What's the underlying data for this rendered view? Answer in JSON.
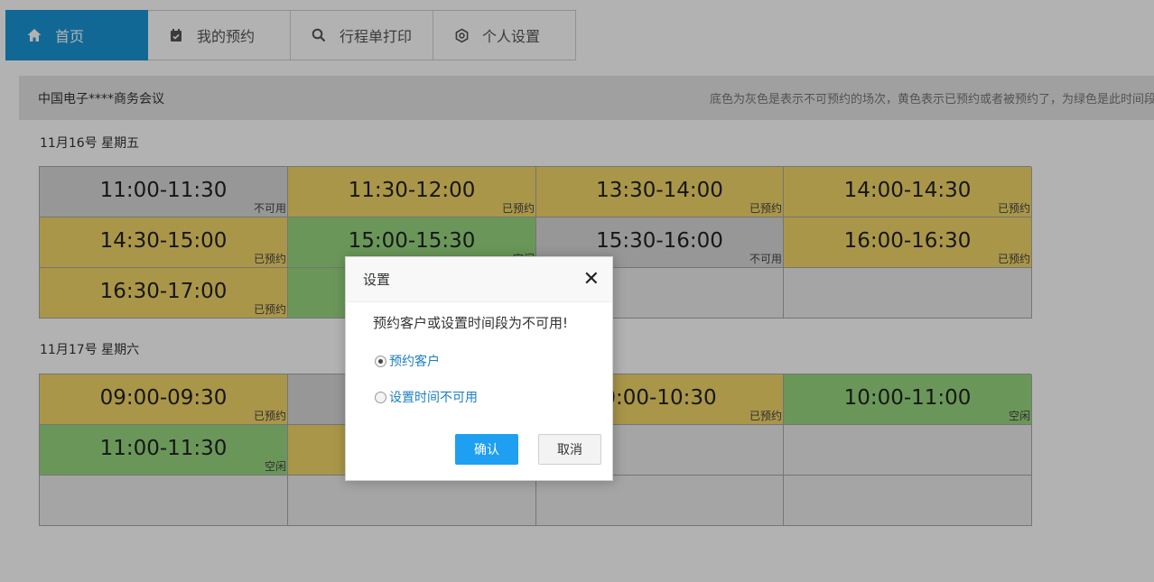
{
  "nav": {
    "tabs": [
      {
        "label": "首页",
        "icon": "home-icon",
        "active": true
      },
      {
        "label": "我的预约",
        "icon": "calendar-check-icon",
        "active": false
      },
      {
        "label": "行程单打印",
        "icon": "search-icon",
        "active": false
      },
      {
        "label": "个人设置",
        "icon": "gear-icon",
        "active": false
      }
    ]
  },
  "infobar": {
    "title": "中国电子****商务会议",
    "legend": "底色为灰色是表示不可预约的场次，黄色表示已预约或者被预约了，为绿色是此时间段"
  },
  "days": [
    {
      "label": "11月16号 星期五",
      "slots": [
        {
          "time": "11:00-11:30",
          "status": "不可用",
          "state": "gray"
        },
        {
          "time": "11:30-12:00",
          "status": "已预约",
          "state": "yellow"
        },
        {
          "time": "13:30-14:00",
          "status": "已预约",
          "state": "yellow"
        },
        {
          "time": "14:00-14:30",
          "status": "已预约",
          "state": "yellow"
        },
        {
          "time": "14:30-15:00",
          "status": "已预约",
          "state": "yellow"
        },
        {
          "time": "15:00-15:30",
          "status": "空闲",
          "state": "green"
        },
        {
          "time": "15:30-16:00",
          "status": "不可用",
          "state": "gray"
        },
        {
          "time": "16:00-16:30",
          "status": "已预约",
          "state": "yellow"
        },
        {
          "time": "16:30-17:00",
          "status": "已预约",
          "state": "yellow"
        },
        {
          "time": "",
          "status": "",
          "state": "green"
        },
        {
          "time": "",
          "status": "",
          "state": "empty"
        },
        {
          "time": "",
          "status": "",
          "state": "empty"
        }
      ]
    },
    {
      "label": "11月17号 星期六",
      "slots": [
        {
          "time": "09:00-09:30",
          "status": "已预约",
          "state": "yellow"
        },
        {
          "time": "",
          "status": "",
          "state": "gray"
        },
        {
          "time": "0:00-10:30",
          "status": "已预约",
          "state": "yellow"
        },
        {
          "time": "10:00-11:00",
          "status": "空闲",
          "state": "green"
        },
        {
          "time": "11:00-11:30",
          "status": "空闲",
          "state": "green"
        },
        {
          "time": "",
          "status": "",
          "state": "yellow"
        },
        {
          "time": "",
          "status": "",
          "state": "empty"
        },
        {
          "time": "",
          "status": "",
          "state": "empty"
        },
        {
          "time": "",
          "status": "",
          "state": "empty"
        },
        {
          "time": "",
          "status": "",
          "state": "empty"
        },
        {
          "time": "",
          "status": "",
          "state": "empty"
        },
        {
          "time": "",
          "status": "",
          "state": "empty"
        }
      ]
    }
  ],
  "modal": {
    "title": "设置",
    "close_icon": "close-icon",
    "message": "预约客户或设置时间段为不可用!",
    "options": [
      {
        "label": "预约客户",
        "checked": true
      },
      {
        "label": "设置时间不可用",
        "checked": false
      }
    ],
    "confirm_label": "确认",
    "cancel_label": "取消"
  },
  "colors": {
    "accent": "#1b95d6",
    "unavailable": "#d9d9d9",
    "booked": "#f2d769",
    "free": "#99d980"
  }
}
